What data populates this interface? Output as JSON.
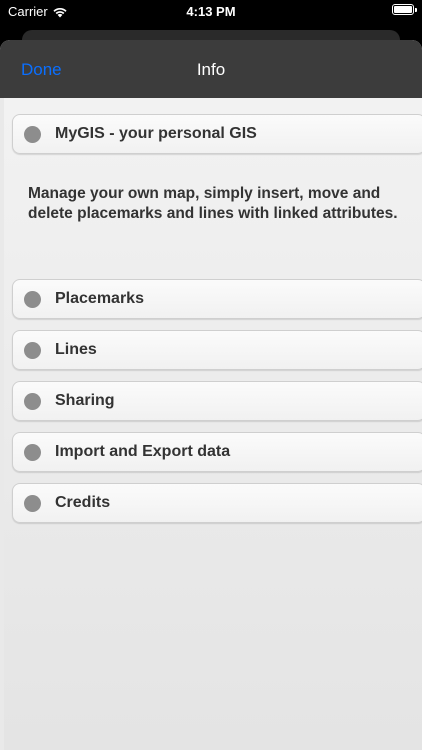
{
  "status_bar": {
    "carrier": "Carrier",
    "time": "4:13 PM"
  },
  "navbar": {
    "done_label": "Done",
    "title": "Info"
  },
  "header_item": {
    "label": "MyGIS - your personal GIS"
  },
  "description": "Manage your own map, simply insert, move and delete placemarks and lines with linked attributes.",
  "menu_items": [
    {
      "label": "Placemarks"
    },
    {
      "label": "Lines"
    },
    {
      "label": "Sharing"
    },
    {
      "label": "Import and Export data"
    },
    {
      "label": "Credits"
    }
  ],
  "colors": {
    "accent": "#0a6fff",
    "navbar_bg": "#3c3c3c",
    "dot": "#8d8d8d",
    "text": "#333333"
  },
  "icons": {
    "wifi": "wifi-icon",
    "battery": "battery-icon",
    "bullet": "circle-bullet-icon"
  }
}
